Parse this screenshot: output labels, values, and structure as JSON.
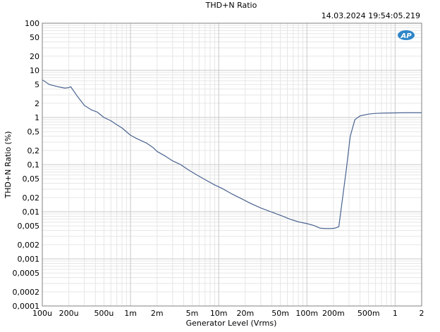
{
  "chart_data": {
    "type": "line",
    "title": "THD+N Ratio",
    "timestamp": "14.03.2024 19:54:05.219",
    "logo_text": "AP",
    "xlabel": "Generator Level (Vrms)",
    "ylabel": "THD+N Ratio (%)",
    "x_scale": "log",
    "y_scale": "log",
    "xlim": [
      0.0001,
      2
    ],
    "ylim": [
      0.0001,
      100
    ],
    "grid": true,
    "line_color": "#4a6391",
    "x_ticks": [
      {
        "value": 0.0001,
        "label": "100u"
      },
      {
        "value": 0.0002,
        "label": "200u"
      },
      {
        "value": 0.0005,
        "label": "500u"
      },
      {
        "value": 0.001,
        "label": "1m"
      },
      {
        "value": 0.002,
        "label": "2m"
      },
      {
        "value": 0.005,
        "label": "5m"
      },
      {
        "value": 0.01,
        "label": "10m"
      },
      {
        "value": 0.02,
        "label": "20m"
      },
      {
        "value": 0.05,
        "label": "50m"
      },
      {
        "value": 0.1,
        "label": "100m"
      },
      {
        "value": 0.2,
        "label": "200m"
      },
      {
        "value": 0.5,
        "label": "500m"
      },
      {
        "value": 1,
        "label": "1"
      },
      {
        "value": 2,
        "label": "2"
      }
    ],
    "y_ticks": [
      {
        "value": 100,
        "label": "100"
      },
      {
        "value": 50,
        "label": "50"
      },
      {
        "value": 20,
        "label": "20"
      },
      {
        "value": 10,
        "label": "10"
      },
      {
        "value": 5,
        "label": "5"
      },
      {
        "value": 2,
        "label": "2"
      },
      {
        "value": 1,
        "label": "1"
      },
      {
        "value": 0.5,
        "label": "0,5"
      },
      {
        "value": 0.2,
        "label": "0,2"
      },
      {
        "value": 0.1,
        "label": "0,1"
      },
      {
        "value": 0.05,
        "label": "0,05"
      },
      {
        "value": 0.02,
        "label": "0,02"
      },
      {
        "value": 0.01,
        "label": "0,01"
      },
      {
        "value": 0.005,
        "label": "0,005"
      },
      {
        "value": 0.002,
        "label": "0,002"
      },
      {
        "value": 0.001,
        "label": "0,001"
      },
      {
        "value": 0.0005,
        "label": "0,0005"
      },
      {
        "value": 0.0002,
        "label": "0,0002"
      },
      {
        "value": 0.0001,
        "label": "0,0001"
      }
    ],
    "series": [
      {
        "points": [
          [
            0.0001,
            6.3
          ],
          [
            0.00012,
            5.0
          ],
          [
            0.00015,
            4.5
          ],
          [
            0.00018,
            4.2
          ],
          [
            0.0002,
            4.3
          ],
          [
            0.00021,
            4.5
          ],
          [
            0.00025,
            2.8
          ],
          [
            0.0003,
            1.8
          ],
          [
            0.00036,
            1.45
          ],
          [
            0.00042,
            1.3
          ],
          [
            0.0005,
            1.0
          ],
          [
            0.0006,
            0.85
          ],
          [
            0.0007,
            0.7
          ],
          [
            0.0008,
            0.6
          ],
          [
            0.001,
            0.42
          ],
          [
            0.0012,
            0.35
          ],
          [
            0.0015,
            0.29
          ],
          [
            0.0018,
            0.23
          ],
          [
            0.002,
            0.19
          ],
          [
            0.0025,
            0.15
          ],
          [
            0.003,
            0.12
          ],
          [
            0.0037,
            0.1
          ],
          [
            0.0045,
            0.078
          ],
          [
            0.0055,
            0.062
          ],
          [
            0.007,
            0.048
          ],
          [
            0.009,
            0.037
          ],
          [
            0.011,
            0.031
          ],
          [
            0.014,
            0.024
          ],
          [
            0.018,
            0.019
          ],
          [
            0.023,
            0.015
          ],
          [
            0.03,
            0.012
          ],
          [
            0.04,
            0.0098
          ],
          [
            0.05,
            0.0084
          ],
          [
            0.065,
            0.0069
          ],
          [
            0.08,
            0.0061
          ],
          [
            0.1,
            0.0056
          ],
          [
            0.12,
            0.0051
          ],
          [
            0.14,
            0.0045
          ],
          [
            0.16,
            0.0044
          ],
          [
            0.19,
            0.0044
          ],
          [
            0.21,
            0.0045
          ],
          [
            0.23,
            0.0048
          ],
          [
            0.28,
            0.08
          ],
          [
            0.31,
            0.4
          ],
          [
            0.35,
            0.9
          ],
          [
            0.4,
            1.08
          ],
          [
            0.5,
            1.18
          ],
          [
            0.6,
            1.22
          ],
          [
            0.75,
            1.24
          ],
          [
            1,
            1.25
          ],
          [
            1.3,
            1.26
          ],
          [
            1.6,
            1.26
          ],
          [
            2,
            1.26
          ]
        ]
      }
    ]
  }
}
